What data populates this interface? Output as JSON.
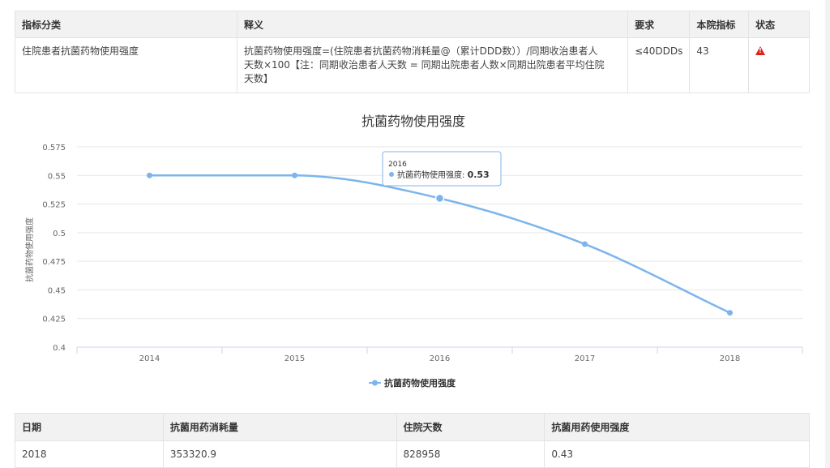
{
  "indicator_table": {
    "headers": {
      "category": "指标分类",
      "definition": "释义",
      "requirement": "要求",
      "value": "本院指标",
      "status": "状态"
    },
    "row": {
      "category": "住院患者抗菌药物使用强度",
      "definition_line1": "抗菌药物使用强度=(住院患者抗菌药物消耗量@（累计DDD数））/同期收治患者人",
      "definition_line2": "天数×100【注：同期收治患者人天数 = 同期出院患者人数×同期出院患者平均住院",
      "definition_line3": "天数】",
      "requirement": "≤40DDDs",
      "value": "43",
      "status_icon": "warning-triangle-icon"
    }
  },
  "chart_data": {
    "type": "line",
    "title": "抗菌药物使用强度",
    "ylabel": "抗菌药物使用强度",
    "xlabel": "",
    "categories": [
      "2014",
      "2015",
      "2016",
      "2017",
      "2018"
    ],
    "series": [
      {
        "name": "抗菌药物使用强度",
        "values": [
          0.55,
          0.55,
          0.53,
          0.49,
          0.43
        ],
        "color": "#7cb5ec"
      }
    ],
    "ylim": [
      0.4,
      0.575
    ],
    "yticks": [
      "0.575",
      "0.55",
      "0.525",
      "0.5",
      "0.475",
      "0.45",
      "0.425",
      "0.4"
    ],
    "grid": true,
    "legend": "bottom-center",
    "tooltip": {
      "title": "2016",
      "series_label": "抗菌药物使用强度: ",
      "value": "0.53"
    }
  },
  "data_table": {
    "headers": {
      "date": "日期",
      "consumption": "抗菌用药消耗量",
      "days": "住院天数",
      "intensity": "抗菌用药使用强度"
    },
    "rows": [
      {
        "date": "2018",
        "consumption": "353320.9",
        "days": "828958",
        "intensity": "0.43"
      }
    ]
  }
}
